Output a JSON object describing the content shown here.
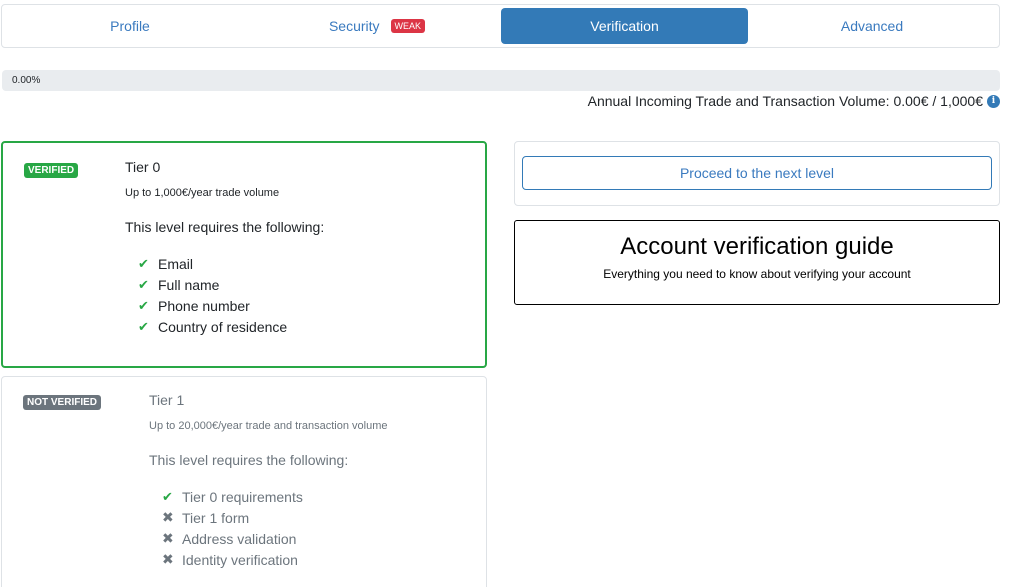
{
  "tabs": [
    {
      "label": "Profile"
    },
    {
      "label": "Security",
      "badge": "WEAK"
    },
    {
      "label": "Verification",
      "active": true
    },
    {
      "label": "Advanced"
    }
  ],
  "progress": {
    "value": 0.0,
    "text": "0.00%"
  },
  "volume": {
    "text": "Annual Incoming Trade and Transaction Volume: 0.00€ / 1,000€"
  },
  "tiers": [
    {
      "badge": "VERIFIED",
      "title": "Tier 0",
      "limit": "Up to 1,000€/year trade volume",
      "requires": "This level requires the following:",
      "items": [
        {
          "label": "Email",
          "done": true
        },
        {
          "label": "Full name",
          "done": true
        },
        {
          "label": "Phone number",
          "done": true
        },
        {
          "label": "Country of residence",
          "done": true
        }
      ]
    },
    {
      "badge": "NOT VERIFIED",
      "title": "Tier 1",
      "limit": "Up to 20,000€/year trade and transaction volume",
      "requires": "This level requires the following:",
      "items": [
        {
          "label": "Tier 0 requirements",
          "done": true
        },
        {
          "label": "Tier 1 form",
          "done": false
        },
        {
          "label": "Address validation",
          "done": false
        },
        {
          "label": "Identity verification",
          "done": false
        }
      ]
    }
  ],
  "next_button": "Proceed to the next level",
  "guide": {
    "title": "Account verification guide",
    "subtitle": "Everything you need to know about verifying your account"
  },
  "colors": {
    "accent": "#337ab7",
    "verified": "#28a745",
    "weak": "#dc3545",
    "not_verified": "#6c757d"
  }
}
